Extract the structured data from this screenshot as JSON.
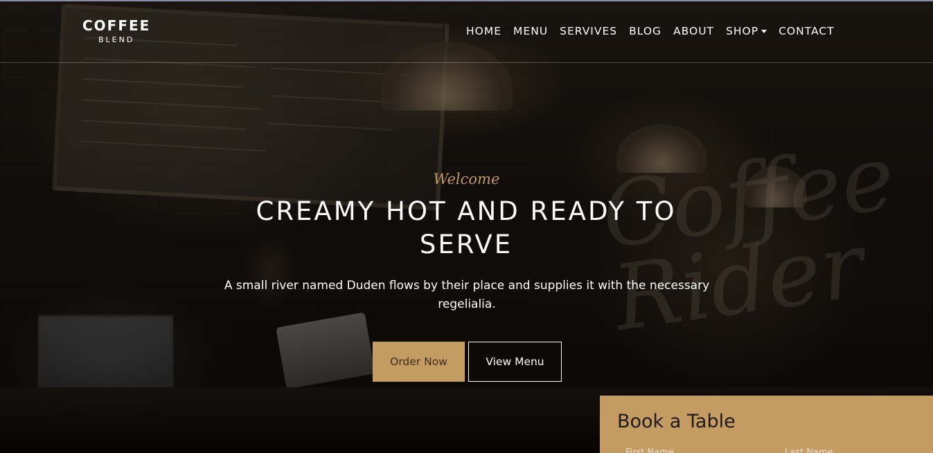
{
  "brand": {
    "name": "COFFEE",
    "tagline": "BLEND"
  },
  "nav": {
    "items": [
      {
        "label": "HOME"
      },
      {
        "label": "MENU"
      },
      {
        "label": "SERVIVES"
      },
      {
        "label": "BLOG"
      },
      {
        "label": "ABOUT"
      },
      {
        "label": "SHOP",
        "has_dropdown": true
      },
      {
        "label": "CONTACT"
      }
    ]
  },
  "hero": {
    "welcome": "Welcome",
    "headline": "CREAMY HOT AND READY TO SERVE",
    "subtext": "A small river named Duden flows by their place and supplies it with the necessary regelialia.",
    "order_button": "Order Now",
    "menu_button": "View Menu"
  },
  "booking": {
    "title": "Book a Table",
    "first_name_placeholder": "First Name",
    "last_name_placeholder": "Last Name"
  },
  "colors": {
    "accent": "#c49b63",
    "text_light": "#ffffff",
    "booking_title": "#1e1a16"
  }
}
